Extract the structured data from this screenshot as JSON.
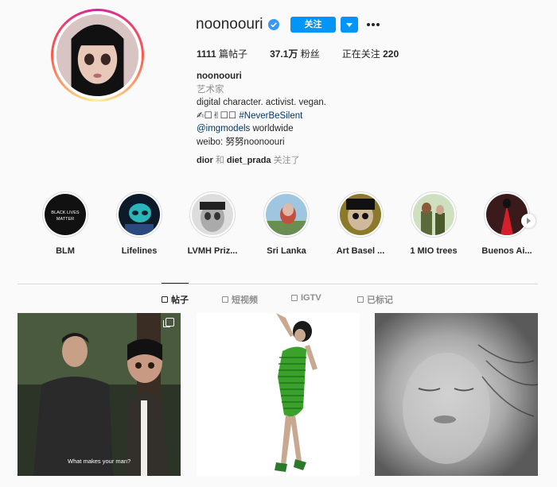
{
  "profile": {
    "username": "noonoouri",
    "follow_label": "关注",
    "stats": {
      "posts_count": "1111",
      "posts_label": " 篇帖子",
      "followers_count": "37.1万",
      "followers_label": " 粉丝",
      "following_label": "正在关注 ",
      "following_count": "220"
    },
    "bio": {
      "name": "noonoouri",
      "category": "艺术家",
      "line1": "digital character. activist. vegan.",
      "line2_prefix": "✍︎︎☐✌︎☐☐ ",
      "line2_hashtag": "#NeverBeSilent",
      "line3_mention": "@imgmodels",
      "line3_suffix": " worldwide",
      "line4": "weibo: 努努noonoouri"
    },
    "followed_by": {
      "user1": "dior",
      "conj": " 和 ",
      "user2": "diet_prada",
      "suffix": " 关注了"
    }
  },
  "highlights": [
    {
      "label": "BLM",
      "img_text": "BLACK LIVES MATTER"
    },
    {
      "label": "Lifelines"
    },
    {
      "label": "LVMH Priz..."
    },
    {
      "label": "Sri Lanka"
    },
    {
      "label": "Art Basel ..."
    },
    {
      "label": "1 MIO trees"
    },
    {
      "label": "Buenos Ai..."
    }
  ],
  "tabs": [
    {
      "label": "帖子"
    },
    {
      "label": "短视频"
    },
    {
      "label": "IGTV"
    },
    {
      "label": "已标记"
    }
  ],
  "posts": [
    {
      "caption": "What makes your man?"
    },
    {
      "caption": ""
    },
    {
      "caption": ""
    }
  ],
  "colors": {
    "accent": "#0095f6",
    "text": "#262626",
    "muted": "#8e8e8e",
    "link": "#00376b"
  }
}
